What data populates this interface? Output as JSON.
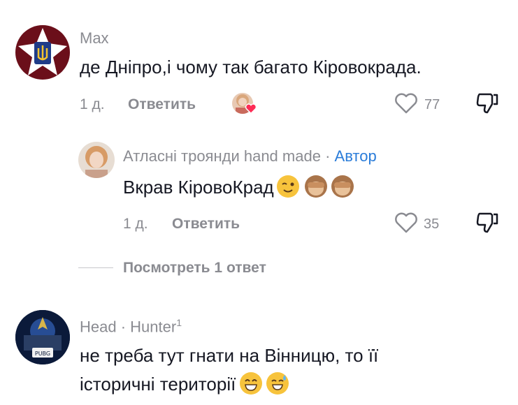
{
  "comments": [
    {
      "username": "Max",
      "text": "де Дніпро,і чому так багато Кіровокрада.",
      "age": "1 д.",
      "reply_label": "Ответить",
      "likes": "77"
    },
    {
      "username": "Атласні троянди hand made",
      "separator": "·",
      "author_badge": "Автор",
      "text": "Вкрав КіровоКрад",
      "age": "1 д.",
      "reply_label": "Ответить",
      "likes": "35"
    },
    {
      "username_part1": "Head",
      "separator": "·",
      "username_part2": "Hunter",
      "username_sup": "1",
      "text_line1": "не треба тут гнати на Вінницю, то її",
      "text_line2": "історичні території",
      "avatar_badge": "PUBG"
    }
  ],
  "view_replies_label": "Посмотреть 1 ответ",
  "icons": {
    "heart": "heart-outline-icon",
    "dislike": "thumbs-down-icon"
  },
  "colors": {
    "text": "#161823",
    "secondary": "#8a8b91",
    "author": "#2a7cd9",
    "emoji": "#f7c33c"
  }
}
